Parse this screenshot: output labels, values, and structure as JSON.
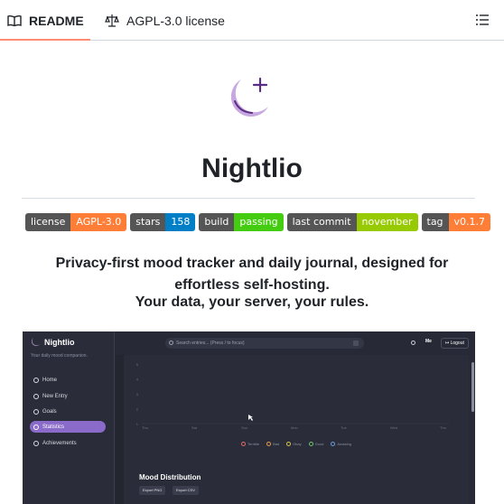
{
  "tabs": {
    "readme_label": "README",
    "license_label": "AGPL-3.0 license"
  },
  "title": "Nightlio",
  "badges": [
    {
      "label": "license",
      "value": "AGPL-3.0",
      "color": "#fe7d37"
    },
    {
      "label": "stars",
      "value": "158",
      "color": "#007ec6"
    },
    {
      "label": "build",
      "value": "passing",
      "color": "#4c1"
    },
    {
      "label": "last commit",
      "value": "november",
      "color": "#97ca00"
    },
    {
      "label": "tag",
      "value": "v0.1.7",
      "color": "#fe7d37"
    }
  ],
  "tagline": "Privacy-first mood tracker and daily journal, designed for effortless self-hosting.",
  "tagline2": "Your data, your server, your rules.",
  "screenshot": {
    "brand": "Nightlio",
    "brand_sub": "Your daily mood companion.",
    "nav": [
      "Home",
      "New Entry",
      "Goals",
      "Statistics",
      "Achievements"
    ],
    "active_nav": "Statistics",
    "search_placeholder": "Search entries... (Press / to focus)",
    "user": "Me",
    "logout": "Logout",
    "chart": {
      "y_ticks": [
        "5",
        "4",
        "3",
        "2",
        "1"
      ],
      "x_ticks": [
        "Thu",
        "Sat",
        "Sun",
        "Mon",
        "Tue",
        "Wed",
        "Thu"
      ],
      "legend": [
        {
          "name": "Terrible",
          "color": "#e06c6c"
        },
        {
          "name": "Bad",
          "color": "#e89a4a"
        },
        {
          "name": "Okay",
          "color": "#d8c24a"
        },
        {
          "name": "Good",
          "color": "#6cc46c"
        },
        {
          "name": "Amazing",
          "color": "#6c9ce0"
        }
      ]
    },
    "mood_distribution": "Mood Distribution",
    "export_png": "Export PNG",
    "export_csv": "Export CSV"
  },
  "colors": {
    "accent": "#8b6bc9",
    "logo": "#c8a8e0",
    "tab_underline": "#fd8c73"
  }
}
